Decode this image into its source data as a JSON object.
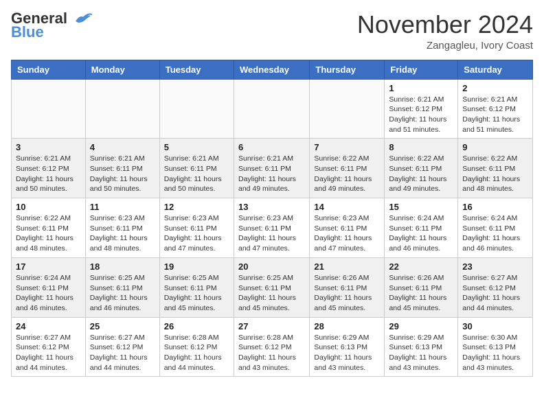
{
  "header": {
    "logo_line1": "General",
    "logo_line2": "Blue",
    "month": "November 2024",
    "location": "Zangagleu, Ivory Coast"
  },
  "weekdays": [
    "Sunday",
    "Monday",
    "Tuesday",
    "Wednesday",
    "Thursday",
    "Friday",
    "Saturday"
  ],
  "weeks": [
    [
      {
        "day": "",
        "info": ""
      },
      {
        "day": "",
        "info": ""
      },
      {
        "day": "",
        "info": ""
      },
      {
        "day": "",
        "info": ""
      },
      {
        "day": "",
        "info": ""
      },
      {
        "day": "1",
        "info": "Sunrise: 6:21 AM\nSunset: 6:12 PM\nDaylight: 11 hours and 51 minutes."
      },
      {
        "day": "2",
        "info": "Sunrise: 6:21 AM\nSunset: 6:12 PM\nDaylight: 11 hours and 51 minutes."
      }
    ],
    [
      {
        "day": "3",
        "info": "Sunrise: 6:21 AM\nSunset: 6:12 PM\nDaylight: 11 hours and 50 minutes."
      },
      {
        "day": "4",
        "info": "Sunrise: 6:21 AM\nSunset: 6:11 PM\nDaylight: 11 hours and 50 minutes."
      },
      {
        "day": "5",
        "info": "Sunrise: 6:21 AM\nSunset: 6:11 PM\nDaylight: 11 hours and 50 minutes."
      },
      {
        "day": "6",
        "info": "Sunrise: 6:21 AM\nSunset: 6:11 PM\nDaylight: 11 hours and 49 minutes."
      },
      {
        "day": "7",
        "info": "Sunrise: 6:22 AM\nSunset: 6:11 PM\nDaylight: 11 hours and 49 minutes."
      },
      {
        "day": "8",
        "info": "Sunrise: 6:22 AM\nSunset: 6:11 PM\nDaylight: 11 hours and 49 minutes."
      },
      {
        "day": "9",
        "info": "Sunrise: 6:22 AM\nSunset: 6:11 PM\nDaylight: 11 hours and 48 minutes."
      }
    ],
    [
      {
        "day": "10",
        "info": "Sunrise: 6:22 AM\nSunset: 6:11 PM\nDaylight: 11 hours and 48 minutes."
      },
      {
        "day": "11",
        "info": "Sunrise: 6:23 AM\nSunset: 6:11 PM\nDaylight: 11 hours and 48 minutes."
      },
      {
        "day": "12",
        "info": "Sunrise: 6:23 AM\nSunset: 6:11 PM\nDaylight: 11 hours and 47 minutes."
      },
      {
        "day": "13",
        "info": "Sunrise: 6:23 AM\nSunset: 6:11 PM\nDaylight: 11 hours and 47 minutes."
      },
      {
        "day": "14",
        "info": "Sunrise: 6:23 AM\nSunset: 6:11 PM\nDaylight: 11 hours and 47 minutes."
      },
      {
        "day": "15",
        "info": "Sunrise: 6:24 AM\nSunset: 6:11 PM\nDaylight: 11 hours and 46 minutes."
      },
      {
        "day": "16",
        "info": "Sunrise: 6:24 AM\nSunset: 6:11 PM\nDaylight: 11 hours and 46 minutes."
      }
    ],
    [
      {
        "day": "17",
        "info": "Sunrise: 6:24 AM\nSunset: 6:11 PM\nDaylight: 11 hours and 46 minutes."
      },
      {
        "day": "18",
        "info": "Sunrise: 6:25 AM\nSunset: 6:11 PM\nDaylight: 11 hours and 46 minutes."
      },
      {
        "day": "19",
        "info": "Sunrise: 6:25 AM\nSunset: 6:11 PM\nDaylight: 11 hours and 45 minutes."
      },
      {
        "day": "20",
        "info": "Sunrise: 6:25 AM\nSunset: 6:11 PM\nDaylight: 11 hours and 45 minutes."
      },
      {
        "day": "21",
        "info": "Sunrise: 6:26 AM\nSunset: 6:11 PM\nDaylight: 11 hours and 45 minutes."
      },
      {
        "day": "22",
        "info": "Sunrise: 6:26 AM\nSunset: 6:11 PM\nDaylight: 11 hours and 45 minutes."
      },
      {
        "day": "23",
        "info": "Sunrise: 6:27 AM\nSunset: 6:12 PM\nDaylight: 11 hours and 44 minutes."
      }
    ],
    [
      {
        "day": "24",
        "info": "Sunrise: 6:27 AM\nSunset: 6:12 PM\nDaylight: 11 hours and 44 minutes."
      },
      {
        "day": "25",
        "info": "Sunrise: 6:27 AM\nSunset: 6:12 PM\nDaylight: 11 hours and 44 minutes."
      },
      {
        "day": "26",
        "info": "Sunrise: 6:28 AM\nSunset: 6:12 PM\nDaylight: 11 hours and 44 minutes."
      },
      {
        "day": "27",
        "info": "Sunrise: 6:28 AM\nSunset: 6:12 PM\nDaylight: 11 hours and 43 minutes."
      },
      {
        "day": "28",
        "info": "Sunrise: 6:29 AM\nSunset: 6:13 PM\nDaylight: 11 hours and 43 minutes."
      },
      {
        "day": "29",
        "info": "Sunrise: 6:29 AM\nSunset: 6:13 PM\nDaylight: 11 hours and 43 minutes."
      },
      {
        "day": "30",
        "info": "Sunrise: 6:30 AM\nSunset: 6:13 PM\nDaylight: 11 hours and 43 minutes."
      }
    ]
  ]
}
